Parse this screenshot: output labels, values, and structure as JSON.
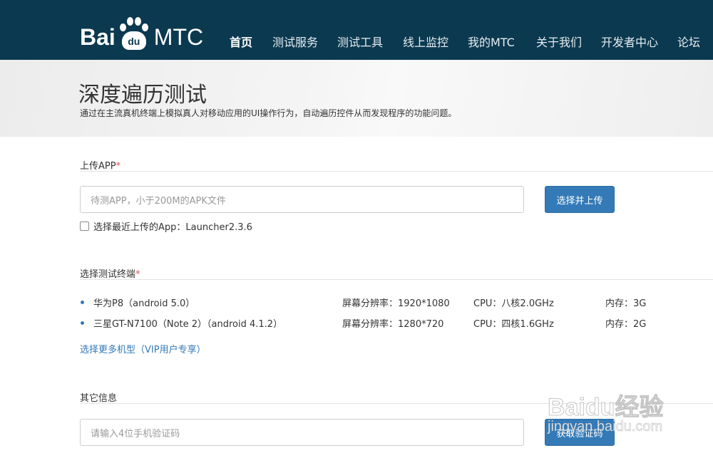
{
  "header": {
    "logo": {
      "left": "Bai",
      "pad": "du",
      "right": "MTC"
    },
    "nav": [
      "首页",
      "测试服务",
      "测试工具",
      "线上监控",
      "我的MTC",
      "关于我们",
      "开发者中心",
      "论坛"
    ],
    "active_nav": "首页"
  },
  "banner": {
    "title": "深度遍历测试",
    "subtitle": "通过在主流真机终端上模拟真人对移动应用的UI操作行为，自动遍历控件从而发现程序的功能问题。"
  },
  "upload": {
    "label": "上传APP",
    "required_mark": "*",
    "placeholder": "待测APP，小于200M的APK文件",
    "button": "选择并上传",
    "recent_label": "选择最近上传的App：Launcher2.3.6"
  },
  "devices": {
    "label": "选择测试终端",
    "required_mark": "*",
    "items": [
      {
        "name": "华为P8（android 5.0）",
        "resolution": "屏幕分辨率：1920*1080",
        "cpu": "CPU：八核2.0GHz",
        "memory": "内存：3G"
      },
      {
        "name": "三星GT-N7100（Note 2）（android 4.1.2）",
        "resolution": "屏幕分辨率：1280*720",
        "cpu": "CPU：四核1.6GHz",
        "memory": "内存：2G"
      }
    ],
    "more_link": "选择更多机型（VIP用户专享）"
  },
  "other": {
    "label": "其它信息",
    "phone_placeholder": "请输入4位手机验证码",
    "code_button": "获取验证码"
  },
  "watermark": {
    "main": "Baidu经验",
    "sub": "jingyan.baidu.com"
  },
  "colors": {
    "header_bg": "#0b3950",
    "primary": "#337ab7",
    "required": "#d9534f"
  }
}
